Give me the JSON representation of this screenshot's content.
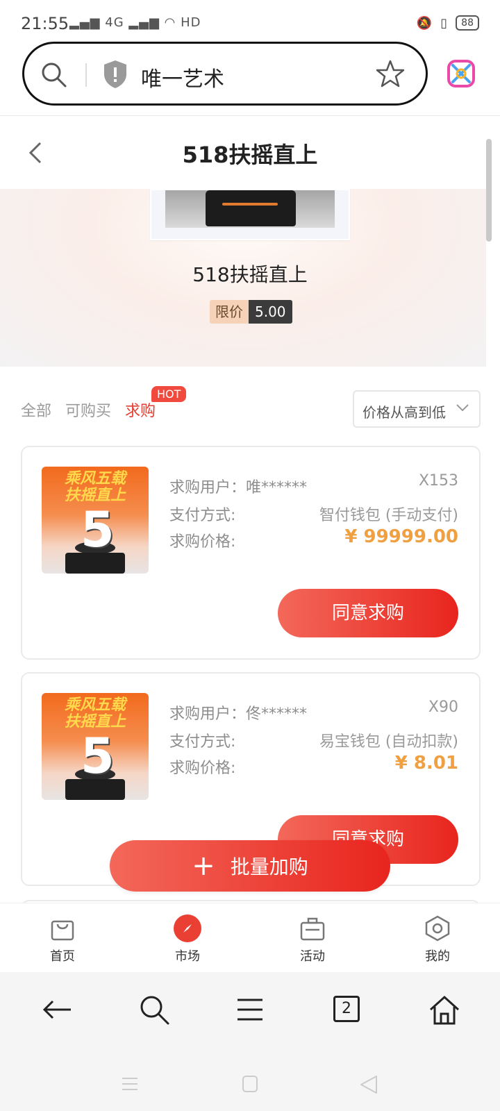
{
  "status": {
    "time": "21:55",
    "network_text": "4G",
    "hd_text": "HD",
    "battery": "88"
  },
  "browser": {
    "site_label": "唯一艺术",
    "tabs_count": "2"
  },
  "page": {
    "title": "518扶摇直上"
  },
  "hero": {
    "name": "518扶摇直上",
    "price_label": "限价",
    "price_value": "5.00"
  },
  "filters": {
    "tabs": [
      {
        "label": "全部"
      },
      {
        "label": "可购买"
      },
      {
        "label": "求购"
      }
    ],
    "active_index": 2,
    "hot_badge": "HOT",
    "sort_label": "价格从高到低"
  },
  "listings": [
    {
      "thumb_text": "乘风五载\n扶摇直上",
      "thumb_number": "5",
      "buyer_label": "求购用户：",
      "buyer_name": "唯******",
      "quantity": "X153",
      "payment_label": "支付方式:",
      "payment_value": "智付钱包 (手动支付)",
      "price_label": "求购价格:",
      "price_value": "¥ 99999.00",
      "action_label": "同意求购"
    },
    {
      "thumb_text": "乘风五载\n扶摇直上",
      "thumb_number": "5",
      "buyer_label": "求购用户：",
      "buyer_name": "佟******",
      "quantity": "X90",
      "payment_label": "支付方式:",
      "payment_value": "易宝钱包 (自动扣款)",
      "price_label": "求购价格:",
      "price_value": "¥ 8.01",
      "action_label": "同意求购"
    }
  ],
  "batch_button": {
    "label": "批量加购"
  },
  "app_nav": [
    {
      "label": "首页",
      "icon": "bag-icon"
    },
    {
      "label": "市场",
      "icon": "compass-icon"
    },
    {
      "label": "活动",
      "icon": "briefcase-icon"
    },
    {
      "label": "我的",
      "icon": "hexagon-icon"
    }
  ],
  "colors": {
    "accent_red": "#e8251e",
    "price_orange": "#f0a040",
    "active_tab": "#e23d32"
  }
}
